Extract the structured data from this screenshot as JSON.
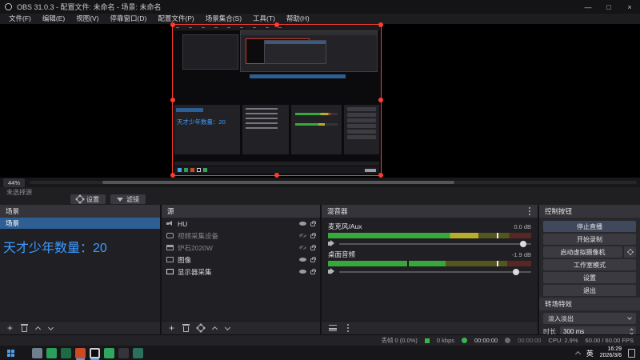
{
  "titlebar": {
    "title": "OBS 31.0.3 - 配置文件: 未命名 - 场景: 未命名",
    "minimize": "—",
    "maximize": "□",
    "close": "×"
  },
  "menubar": {
    "items": [
      "文件(F)",
      "编辑(E)",
      "视图(V)",
      "停靠窗口(D)",
      "配置文件(P)",
      "场景集合(S)",
      "工具(T)",
      "帮助(H)"
    ]
  },
  "preview": {
    "zoom_chip": "44%",
    "overlay_text": "天才少年数量：20"
  },
  "source_toolbar": {
    "no_source": "未选择源",
    "settings": "设置",
    "filters": "滤镜"
  },
  "scenes": {
    "header": "场景",
    "items": [
      {
        "name": "场景"
      }
    ],
    "big_text": "天才少年数量：20"
  },
  "sources": {
    "header": "源",
    "items": [
      {
        "name": "HU",
        "visible": true,
        "locked": false
      },
      {
        "name": "视频采集设备",
        "visible": false,
        "locked": false
      },
      {
        "name": "炉石2020W",
        "visible": false,
        "locked": false
      },
      {
        "name": "图像",
        "visible": true,
        "locked": false
      },
      {
        "name": "显示器采集",
        "visible": true,
        "locked": false
      }
    ]
  },
  "mixer": {
    "header": "混音器",
    "channels": [
      {
        "name": "麦克风/Aux",
        "db": "0.0 dB",
        "level": 0.74,
        "slider": 0.96
      },
      {
        "name": "桌面音频",
        "db": "-1.9 dB",
        "level": 0.58,
        "slider": 0.92
      }
    ]
  },
  "controls": {
    "header": "控制按钮",
    "buttons": [
      "停止直播",
      "开始录制",
      "启动虚拟摄像机",
      "工作室模式",
      "设置",
      "退出"
    ]
  },
  "transitions": {
    "header": "转场特效",
    "transition": "淡入淡出",
    "duration_label": "时长",
    "duration_value": "300 ms"
  },
  "statusbar": {
    "dropped_frames": "丢帧 0 (0.0%)",
    "bitrate": "0 kbps",
    "live_time": "00:00:00",
    "rec_time": "00:00:00",
    "cpu": "CPU: 2.9%",
    "fps": "60.00 / 60.00 FPS"
  },
  "taskbar": {
    "input_indicator": "英",
    "time": "16:29",
    "date": "2026/3/6"
  },
  "colors": {
    "accent_blue": "#3d9aff",
    "selection_blue": "#2d5e94",
    "meter_green": "#36a93a",
    "meter_yellow": "#b7ae28",
    "source_selection_red": "#ff3b30"
  }
}
